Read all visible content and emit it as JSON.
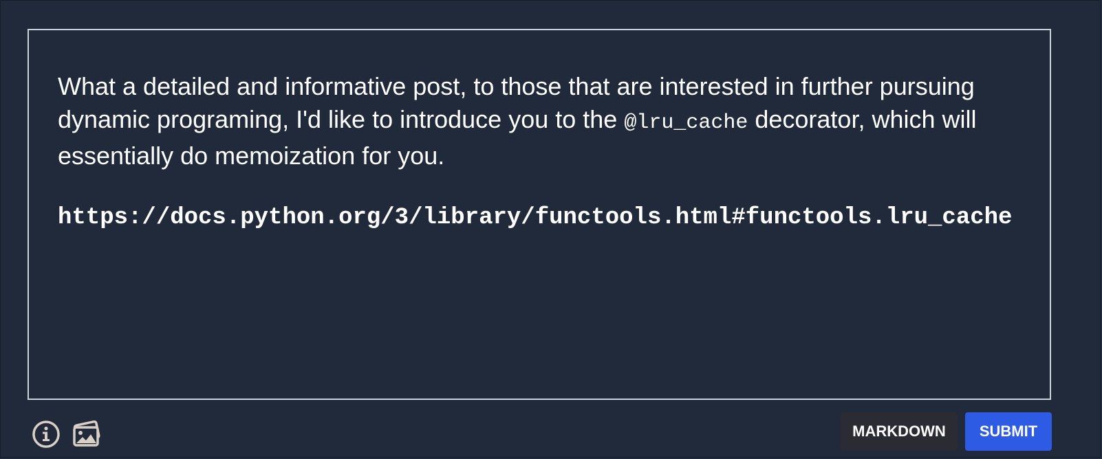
{
  "editor": {
    "paragraph": {
      "text_before": "What a detailed and informative post, to those that are interested in further pursuing dynamic programing, I'd like to introduce you to the ",
      "code": "@lru_cache",
      "text_after": " decorator, which will essentially do memoization for you."
    },
    "url_text": "https://docs.python.org/3/library/functools.html#functools.lru_cache"
  },
  "toolbar": {
    "info_icon": "info-icon",
    "image_icon": "image-upload-icon",
    "markdown_label": "MARKDOWN",
    "submit_label": "SUBMIT"
  },
  "colors": {
    "background": "#212a3b",
    "editor_border": "#c9d3dc",
    "icon_color": "#d9cfc5",
    "markdown_button": "#2b2b34",
    "submit_button": "#2d5be3",
    "text": "#ffffff"
  }
}
